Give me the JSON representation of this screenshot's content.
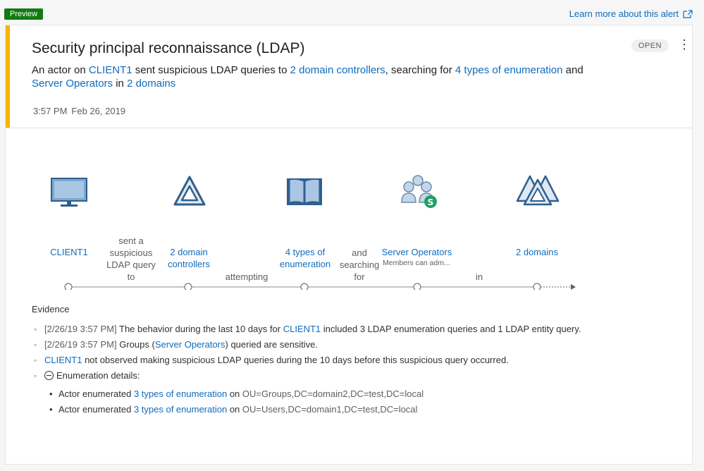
{
  "header": {
    "preview_badge": "Preview",
    "learn_more": "Learn more about this alert"
  },
  "alert": {
    "title": "Security principal reconnaissance (LDAP)",
    "status": "OPEN",
    "desc": {
      "p1": "An actor on ",
      "client": "CLIENT1",
      "p2": " sent suspicious LDAP queries to ",
      "dcs": "2 domain controllers",
      "p3": ", searching for ",
      "enum": "4 types of enumeration",
      "p4": " and ",
      "group": "Server Operators",
      "p5": " in ",
      "domains": "2 domains"
    },
    "time": "3:57 PM",
    "date": "Feb 26, 2019"
  },
  "flow": {
    "nodes": [
      {
        "label": "CLIENT1",
        "icon": "monitor-icon"
      },
      {
        "label": "2 domain\ncontrollers",
        "icon": "domain-controller-icon"
      },
      {
        "label": "4 types of\nenumeration",
        "icon": "book-icon"
      },
      {
        "label": "Server Operators",
        "sublabel": "Members can adm...",
        "icon": "group-icon"
      },
      {
        "label": "2 domains",
        "icon": "domains-icon"
      }
    ],
    "connectors": [
      "sent a\nsuspicious\nLDAP query\nto",
      "attempting",
      "and\nsearching\nfor",
      "in"
    ]
  },
  "evidence": {
    "title": "Evidence",
    "items": [
      {
        "ts": "[2/26/19 3:57 PM]",
        "t1": " The behavior during the last 10 days for ",
        "link": "CLIENT1",
        "t2": " included 3 LDAP enumeration queries and 1 LDAP entity query."
      },
      {
        "ts": "[2/26/19 3:57 PM]",
        "t1": " Groups (",
        "link": "Server Operators",
        "t2": ") queried are sensitive."
      },
      {
        "link": "CLIENT1",
        "t2": " not observed making suspicious LDAP queries during the 10 days before this suspicious query occurred."
      },
      {
        "label": "Enumeration details:"
      }
    ],
    "details": [
      {
        "t1": "Actor enumerated ",
        "link": "3 types of enumeration",
        "t2": " on ",
        "code": "OU=Groups,DC=domain2,DC=test,DC=local"
      },
      {
        "t1": "Actor enumerated ",
        "link": "3 types of enumeration",
        "t2": " on ",
        "code": "OU=Users,DC=domain1,DC=test,DC=local"
      }
    ]
  },
  "colors": {
    "accent": "#f7b500",
    "link": "#0f6cbd",
    "preview": "#107c10",
    "icon_blue": "#3a6ea5"
  }
}
